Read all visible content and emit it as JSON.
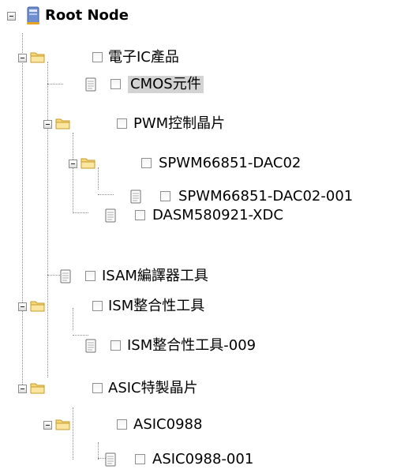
{
  "tree": {
    "root_label": "Root Node",
    "nodes": [
      {
        "id": "n1",
        "label": "電子IC產品",
        "type": "folder"
      },
      {
        "id": "n2",
        "label": "CMOS元件",
        "type": "file",
        "selected": true
      },
      {
        "id": "n3",
        "label": "PWM控制晶片",
        "type": "folder"
      },
      {
        "id": "n4",
        "label": "SPWM66851-DAC02",
        "type": "folder"
      },
      {
        "id": "n5",
        "label": "SPWM66851-DAC02-001",
        "type": "file"
      },
      {
        "id": "n6",
        "label": "DASM580921-XDC",
        "type": "file"
      },
      {
        "id": "n7",
        "label": "ISAM編譯器工具",
        "type": "file"
      },
      {
        "id": "n8",
        "label": "ISM整合性工具",
        "type": "folder"
      },
      {
        "id": "n9",
        "label": "ISM整合性工具-009",
        "type": "file"
      },
      {
        "id": "n10",
        "label": "ASIC特製晶片",
        "type": "folder"
      },
      {
        "id": "n11",
        "label": "ASIC0988",
        "type": "folder"
      },
      {
        "id": "n12",
        "label": "ASIC0988-001",
        "type": "file"
      }
    ]
  },
  "colors": {
    "folder_fill": "#f5d87a",
    "folder_edge": "#c89a2a",
    "selected_bg": "#d3d3d3",
    "guide_line": "#8a8a8a"
  },
  "icons": {
    "root": "computer-icon",
    "folder": "folder-open-icon",
    "file": "document-icon",
    "toggle": "collapse-minus-icon"
  }
}
